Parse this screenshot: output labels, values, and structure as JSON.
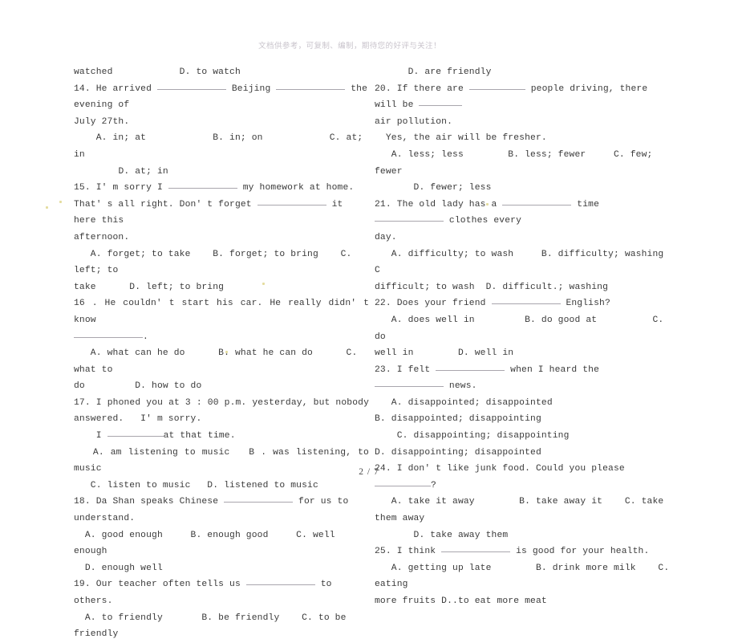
{
  "document": {
    "promo_header": "文档供参考，可复制、编制，期待您的好评与关注！",
    "footer": "2 / 7"
  },
  "left_column": {
    "lines": [
      {
        "id": "l1",
        "text": "watched            D. to watch"
      },
      {
        "id": "l2",
        "pre": "14. He arrived ",
        "blank1": "w-long",
        "mid": " Beijing ",
        "blank2": "w-long",
        "post": " the evening of"
      },
      {
        "id": "l3",
        "text": "July 27th."
      },
      {
        "id": "l4",
        "text": "    A. in; at            B. in; on            C. at; in"
      },
      {
        "id": "l5",
        "text": "        D. at; in"
      },
      {
        "id": "l6",
        "pre": "15. I' m sorry I ",
        "blank1": "w-long",
        "mid": " my homework at home.",
        "blank2": "",
        "post": ""
      },
      {
        "id": "l7",
        "pre": "That' s all right. Don' t forget ",
        "blank1": "w-long",
        "mid": " it here this",
        "blank2": "",
        "post": ""
      },
      {
        "id": "l8",
        "text": "afternoon."
      },
      {
        "id": "l9",
        "text": "   A. forget; to take    B. forget; to bring    C. left; to"
      },
      {
        "id": "l10",
        "text": "take      D. left; to bring"
      },
      {
        "id": "l11",
        "text": "16 . He couldn' t start his car. He really didn' t know",
        "justify": true
      },
      {
        "id": "l12",
        "pre": "",
        "blank1": "w-long",
        "mid": ".",
        "blank2": "",
        "post": ""
      },
      {
        "id": "l13",
        "text": "   A. what can he do      B. what he can do      C. what to"
      },
      {
        "id": "l14",
        "text": "do         D. how to do"
      },
      {
        "id": "l15",
        "text": "17. I phoned you at 3 : 00 p.m. yesterday, but nobody",
        "justify": true
      },
      {
        "id": "l16",
        "text": "answered.   I' m sorry."
      },
      {
        "id": "l17",
        "pre": "    I ",
        "blank1": "w-med",
        "mid": "at that time.",
        "blank2": "",
        "post": ""
      },
      {
        "id": "l18",
        "text": "   A. am listening to music   B . was listening, to music",
        "justify": true
      },
      {
        "id": "l19",
        "text": "   C. listen to music   D. listened to music"
      },
      {
        "id": "l20",
        "pre": "18. Da Shan speaks Chinese ",
        "blank1": "w-long",
        "mid": " for us to understand.",
        "blank2": "",
        "post": ""
      },
      {
        "id": "l21",
        "text": "  A. good enough     B. enough good     C. well enough"
      },
      {
        "id": "l22",
        "text": "  D. enough well"
      },
      {
        "id": "l23",
        "pre": "19. Our teacher often tells us ",
        "blank1": "w-long",
        "mid": " to others.",
        "blank2": "",
        "post": ""
      },
      {
        "id": "l24",
        "text": "  A. to friendly       B. be friendly    C. to be friendly"
      }
    ]
  },
  "right_column": {
    "lines": [
      {
        "id": "r1",
        "text": "      D. are friendly"
      },
      {
        "id": "r2",
        "pre": "20. If there are ",
        "blank1": "w-med",
        "mid": " people driving, there will be ",
        "blank2": "w-short",
        "post": ""
      },
      {
        "id": "r3",
        "text": "air pollution."
      },
      {
        "id": "r4",
        "text": "  Yes, the air will be fresher."
      },
      {
        "id": "r5",
        "text": "   A. less; less        B. less; fewer     C. few; fewer"
      },
      {
        "id": "r6",
        "text": "       D. fewer; less"
      },
      {
        "id": "r7",
        "pre": "21. The old lady has a ",
        "blank1": "w-long",
        "mid": " time ",
        "blank2": "w-long",
        "post": " clothes every"
      },
      {
        "id": "r8",
        "text": "day."
      },
      {
        "id": "r9",
        "text": "   A. difficulty; to wash     B. difficulty; washing  C"
      },
      {
        "id": "r10",
        "text": "difficult; to wash  D. difficult.; washing"
      },
      {
        "id": "r11",
        "pre": "22. Does your friend ",
        "blank1": "w-long",
        "mid": " English?",
        "blank2": "",
        "post": ""
      },
      {
        "id": "r12",
        "text": "   A. does well in         B. do good at          C. do"
      },
      {
        "id": "r13",
        "text": "well in        D. well in"
      },
      {
        "id": "r14",
        "pre": "23. I felt ",
        "blank1": "w-long",
        "mid": " when I heard the ",
        "blank2": "w-long",
        "post": " news."
      },
      {
        "id": "r15",
        "text": "   A. disappointed; disappointed"
      },
      {
        "id": "r16",
        "text": "B. disappointed; disappointing"
      },
      {
        "id": "r17",
        "text": "    C. disappointing; disappointing"
      },
      {
        "id": "r18",
        "text": "D. disappointing; disappointed"
      },
      {
        "id": "r19",
        "pre": "24. I don' t like junk food. Could you please ",
        "blank1": "w-med",
        "mid": "?",
        "blank2": "",
        "post": ""
      },
      {
        "id": "r20",
        "text": "   A. take it away        B. take away it    C. take them away"
      },
      {
        "id": "r21",
        "text": "       D. take away them"
      },
      {
        "id": "r22",
        "pre": "25. I think ",
        "blank1": "w-long",
        "mid": " is good for your health.",
        "blank2": "",
        "post": ""
      },
      {
        "id": "r23",
        "text": "   A. getting up late        B. drink more milk    C. eating"
      },
      {
        "id": "r24",
        "text": "more fruits D..to eat more meat"
      }
    ]
  }
}
